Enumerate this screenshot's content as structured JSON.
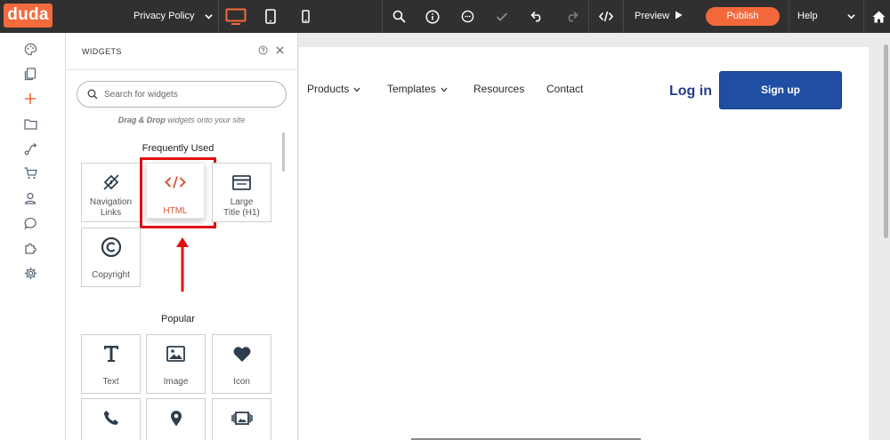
{
  "topbar": {
    "logo": "duda",
    "page_selector": "Privacy Policy",
    "preview_label": "Preview",
    "publish_label": "Publish",
    "help_label": "Help"
  },
  "panel": {
    "title": "WIDGETS",
    "search_placeholder": "Search for widgets",
    "drag_hint_bold": "Drag & Drop",
    "drag_hint_rest": " widgets onto your site",
    "frequently_used_title": "Frequently Used",
    "popular_title": "Popular",
    "frequently_used": [
      {
        "label_line1": "Navigation",
        "label_line2": "Links",
        "icon": "navigation-links-icon"
      },
      {
        "label_line1": "HTML",
        "label_line2": "",
        "icon": "code-icon"
      },
      {
        "label_line1": "Large",
        "label_line2": "Title (H1)",
        "icon": "large-title-icon"
      },
      {
        "label_line1": "Copyright",
        "label_line2": "",
        "icon": "copyright-icon"
      }
    ],
    "popular": [
      {
        "label": "Text",
        "icon": "text-icon"
      },
      {
        "label": "Image",
        "icon": "image-icon"
      },
      {
        "label": "Icon",
        "icon": "heart-icon"
      },
      {
        "label": "",
        "icon": "phone-icon"
      },
      {
        "label": "",
        "icon": "map-pin-icon"
      },
      {
        "label": "",
        "icon": "gallery-icon"
      }
    ]
  },
  "site": {
    "nav": [
      {
        "label": "Products",
        "dropdown": true
      },
      {
        "label": "Templates",
        "dropdown": true
      },
      {
        "label": "Resources",
        "dropdown": false
      },
      {
        "label": "Contact",
        "dropdown": false
      }
    ],
    "login_label": "Log in",
    "signup_label": "Sign up"
  },
  "colors": {
    "brand_orange": "#f36a3c",
    "topbar_bg": "#303030",
    "highlight_red": "#e00f12",
    "signup_blue": "#1f4ea3",
    "login_blue": "#233e8b"
  }
}
